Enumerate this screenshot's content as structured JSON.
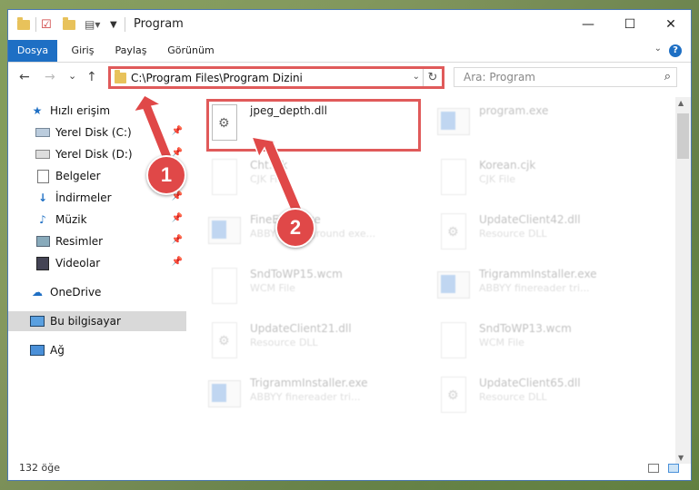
{
  "window": {
    "title": "Program",
    "minimize": "—",
    "maximize": "☐",
    "close": "✕"
  },
  "ribbon": {
    "tabs": [
      "Dosya",
      "Giriş",
      "Paylaş",
      "Görünüm"
    ],
    "help": "?"
  },
  "nav": {
    "back": "←",
    "forward": "→",
    "recent": "⌄",
    "up": "↑",
    "address": "C:\\Program Files\\Program Dizini",
    "search_placeholder": "Ara: Program"
  },
  "sidebar": {
    "items": [
      {
        "label": "Hızlı erişim",
        "icon": "star-icon"
      },
      {
        "label": "Yerel Disk (C:)",
        "icon": "drive-icon"
      },
      {
        "label": "Yerel Disk (D:)",
        "icon": "drive-icon"
      },
      {
        "label": "Belgeler",
        "icon": "documents-icon"
      },
      {
        "label": "İndirmeler",
        "icon": "download-icon"
      },
      {
        "label": "Müzik",
        "icon": "music-icon"
      },
      {
        "label": "Resimler",
        "icon": "pictures-icon"
      },
      {
        "label": "Videolar",
        "icon": "videos-icon"
      },
      {
        "label": "OneDrive",
        "icon": "cloud-icon"
      },
      {
        "label": "Bu bilgisayar",
        "icon": "computer-icon"
      },
      {
        "label": "Ağ",
        "icon": "network-icon"
      }
    ]
  },
  "files": [
    {
      "name": "jpeg_depth.dll",
      "type": ""
    },
    {
      "name": "program.exe",
      "type": ""
    },
    {
      "name": "Cht.cjk",
      "type": "CJK File"
    },
    {
      "name": "Korean.cjk",
      "type": "CJK File"
    },
    {
      "name": "FineExec.exe",
      "type": "ABBYY Background exe..."
    },
    {
      "name": "UpdateClient42.dll",
      "type": "Resource DLL"
    },
    {
      "name": "SndToWP15.wcm",
      "type": "WCM File"
    },
    {
      "name": "TrigrammInstaller.exe",
      "type": "ABBYY finereader tri..."
    },
    {
      "name": "UpdateClient21.dll",
      "type": "Resource DLL"
    },
    {
      "name": "SndToWP13.wcm",
      "type": "WCM File"
    },
    {
      "name": "TrigrammInstaller.exe",
      "type": "ABBYY finereader tri..."
    },
    {
      "name": "UpdateClient65.dll",
      "type": "Resource DLL"
    }
  ],
  "annotations": {
    "step1": "1",
    "step2": "2"
  },
  "status": {
    "count": "132 öğe"
  },
  "colors": {
    "accent": "#1e6fc4",
    "highlight": "#e05a5a"
  }
}
